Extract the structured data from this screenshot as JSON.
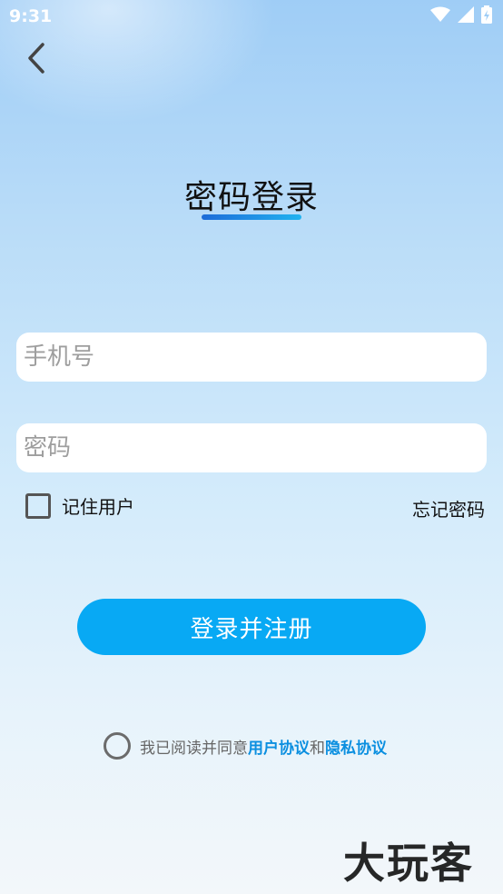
{
  "status_bar": {
    "time": "9:31",
    "icons": [
      "wifi-icon",
      "signal-icon",
      "battery-icon"
    ]
  },
  "nav": {
    "back_icon": "chevron-left-icon"
  },
  "page": {
    "title": "密码登录"
  },
  "form": {
    "phone_placeholder": "手机号",
    "phone_value": "",
    "password_placeholder": "密码",
    "password_value": "",
    "remember_label": "记住用户",
    "remember_checked": false,
    "forgot_label": "忘记密码",
    "submit_label": "登录并注册"
  },
  "agreement": {
    "checked": false,
    "prefix": "我已阅读并同意",
    "user_agreement": "用户协议",
    "conjunction": "和",
    "privacy_policy": "隐私协议"
  },
  "watermark": {
    "text": "大玩客"
  },
  "colors": {
    "accent": "#08a9f4",
    "link": "#0b8fe0",
    "underline_start": "#1d6bd8",
    "underline_end": "#21b3f0"
  }
}
